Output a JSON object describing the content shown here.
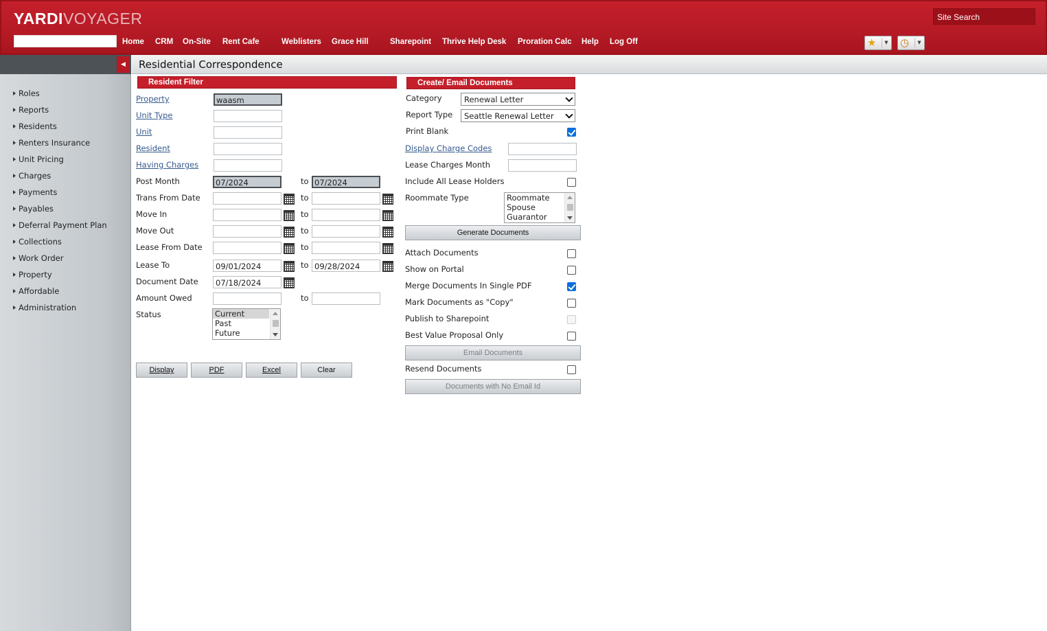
{
  "header": {
    "logo_bold": "YARDI",
    "logo_light": "VOYAGER",
    "site_search": "Site Search",
    "nav": [
      "Home",
      "CRM",
      "On-Site",
      "Rent Cafe",
      "Weblisters",
      "Grace Hill",
      "Sharepoint",
      "Thrive Help Desk",
      "Proration Calc",
      "Help",
      "Log Off"
    ],
    "favorites_icon": "star-icon",
    "history_icon": "clock-icon",
    "accent_color": "#c41f2a"
  },
  "sidebar": {
    "items": [
      "Roles",
      "Reports",
      "Residents",
      "Renters Insurance",
      "Unit Pricing",
      "Charges",
      "Payments",
      "Payables",
      "Deferral Payment Plan",
      "Collections",
      "Work Order",
      "Property",
      "Affordable",
      "Administration"
    ]
  },
  "page": {
    "title": "Residential Correspondence"
  },
  "filter": {
    "header": "Resident Filter",
    "property_label": "Property",
    "property_value": "waasm",
    "unit_type_label": "Unit Type",
    "unit_label": "Unit",
    "resident_label": "Resident",
    "having_charges_label": "Having Charges",
    "post_month_label": "Post Month",
    "post_month_from": "07/2024",
    "post_month_to": "07/2024",
    "trans_from_label": "Trans From Date",
    "move_in_label": "Move In",
    "move_out_label": "Move Out",
    "lease_from_label": "Lease From Date",
    "lease_to_label": "Lease To",
    "lease_to_from": "09/01/2024",
    "lease_to_to": "09/28/2024",
    "document_date_label": "Document Date",
    "document_date_value": "07/18/2024",
    "amount_owed_label": "Amount Owed",
    "status_label": "Status",
    "status_options": [
      "Current",
      "Past",
      "Future"
    ],
    "to": "to",
    "buttons": {
      "display": "Display",
      "pdf": "PDF",
      "excel": "Excel",
      "clear": "Clear"
    }
  },
  "create": {
    "header": "Create/ Email Documents",
    "category_label": "Category",
    "category_value": "Renewal Letter",
    "report_type_label": "Report Type",
    "report_type_value": "Seattle Renewal Letter",
    "print_blank_label": "Print Blank",
    "display_charge_codes_label": "Display Charge Codes",
    "lease_charges_month_label": "Lease Charges Month",
    "include_all_label": "Include All Lease Holders",
    "roommate_type_label": "Roommate Type",
    "roommate_options": [
      "Roommate",
      "Spouse",
      "Guarantor"
    ],
    "generate_button": "Generate Documents",
    "attach_label": "Attach Documents",
    "show_portal_label": "Show on Portal",
    "merge_label": "Merge Documents In Single PDF",
    "mark_copy_label": "Mark Documents as \"Copy\"",
    "publish_label": "Publish to Sharepoint",
    "best_value_label": "Best Value Proposal Only",
    "email_button": "Email Documents",
    "resend_label": "Resend Documents",
    "no_email_button": "Documents with No Email Id",
    "checkboxes": {
      "print_blank": true,
      "include_all": false,
      "attach": false,
      "show_portal": false,
      "merge": true,
      "mark_copy": false,
      "publish": false,
      "best_value": false,
      "resend": false
    }
  }
}
